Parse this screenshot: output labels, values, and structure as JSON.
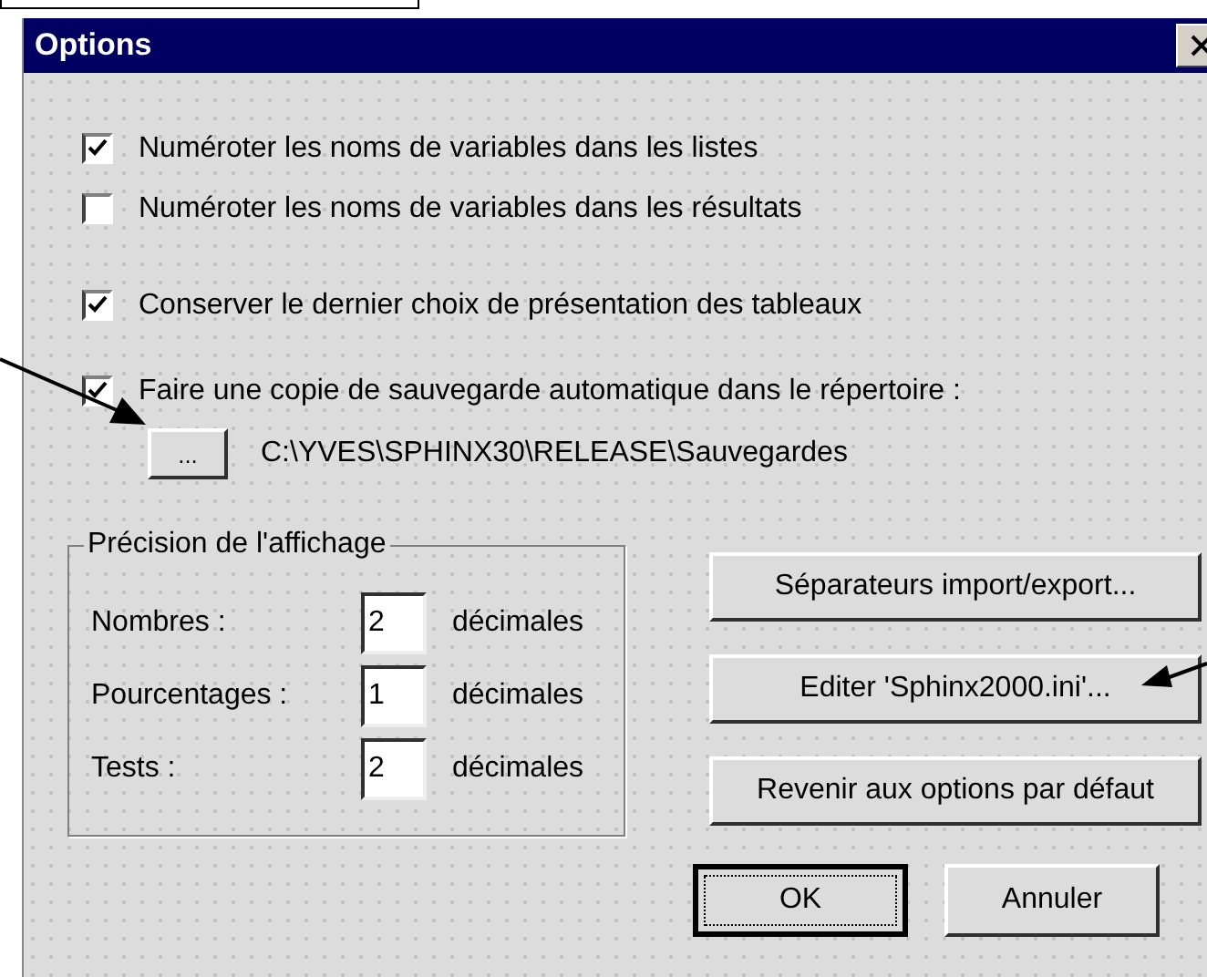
{
  "window": {
    "title": "Options"
  },
  "checkboxes": [
    {
      "label": "Numéroter les noms de variables dans les listes",
      "checked": true
    },
    {
      "label": "Numéroter les noms de variables dans les résultats",
      "checked": false
    },
    {
      "label": "Conserver le dernier choix de présentation des tableaux",
      "checked": true
    },
    {
      "label": "Faire une copie de sauvegarde automatique dans le répertoire :",
      "checked": true
    }
  ],
  "backup": {
    "browse_button": "...",
    "path": "C:\\YVES\\SPHINX30\\RELEASE\\Sauvegardes"
  },
  "precision": {
    "title": "Précision de l'affichage",
    "rows": [
      {
        "label": "Nombres :",
        "value": "2",
        "unit": "décimales"
      },
      {
        "label": "Pourcentages :",
        "value": "1",
        "unit": "décimales"
      },
      {
        "label": "Tests :",
        "value": "2",
        "unit": "décimales"
      }
    ]
  },
  "side_buttons": [
    "Séparateurs import/export...",
    "Editer 'Sphinx2000.ini'...",
    "Revenir aux options par défaut"
  ],
  "dialog_buttons": [
    {
      "label": "OK",
      "default": true
    },
    {
      "label": "Annuler",
      "default": false
    }
  ]
}
